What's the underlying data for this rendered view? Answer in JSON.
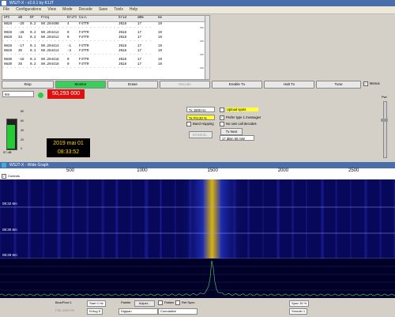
{
  "window": {
    "title": "WSJT-X - v2.0.1 by K1JT"
  },
  "menu": [
    "File",
    "Configurations",
    "View",
    "Mode",
    "Decode",
    "Save",
    "Tools",
    "Help"
  ],
  "decode": {
    "headers": [
      "UTC",
      "dB",
      "DT",
      "Freq",
      "Drift",
      "Call",
      "Grid",
      "dBm",
      "km"
    ],
    "rows": [
      {
        "utc": "0828",
        "db": "-29",
        "dt": "0.2",
        "freq": "50.294408",
        "drift": "4",
        "call": "F4TTR",
        "grid": "JN18",
        "dbm": "17",
        "km": "19"
      },
      {
        "sep": true,
        "tag": "6m"
      },
      {
        "utc": "0828",
        "db": "-28",
        "dt": "0.2",
        "freq": "50.294412",
        "drift": "0",
        "call": "F4TTR",
        "grid": "JN18",
        "dbm": "17",
        "km": "19"
      },
      {
        "utc": "0828",
        "db": "34",
        "dt": "0.2",
        "freq": "50.294412",
        "drift": "0",
        "call": "F4TTR",
        "grid": "JN18",
        "dbm": "17",
        "km": "19"
      },
      {
        "sep": true,
        "tag": "6m"
      },
      {
        "utc": "0828",
        "db": "-17",
        "dt": "0.1",
        "freq": "50.294414",
        "drift": "-1",
        "call": "F4TTR",
        "grid": "JN18",
        "dbm": "17",
        "km": "19"
      },
      {
        "utc": "0828",
        "db": "35",
        "dt": "0.1",
        "freq": "50.294414",
        "drift": "-3",
        "call": "F4TTR",
        "grid": "JN18",
        "dbm": "17",
        "km": "19"
      },
      {
        "sep": true,
        "tag": "6m"
      },
      {
        "utc": "0830",
        "db": "-16",
        "dt": "0.2",
        "freq": "50.294416",
        "drift": "0",
        "call": "F4TTR",
        "grid": "JN18",
        "dbm": "17",
        "km": "19"
      },
      {
        "utc": "0830",
        "db": "35",
        "dt": "0.2",
        "freq": "50.294416",
        "drift": "0",
        "call": "F4TTR",
        "grid": "JN18",
        "dbm": "17",
        "km": "19"
      },
      {
        "sep": true,
        "tag": "6m"
      }
    ]
  },
  "buttons": {
    "stop": "Stop",
    "monitor": "Monitor",
    "erase": "Erase",
    "decode": "Decode",
    "enable_tx": "Enable Tx",
    "halt_tx": "Halt Tx",
    "tune": "Tune",
    "menus": "Menus"
  },
  "band": "6m",
  "frequency": "50,293 000",
  "meter": {
    "ticks": [
      "80",
      "60",
      "40",
      "20",
      "0"
    ],
    "value": "57 dB",
    "level_fraction": 0.78
  },
  "clock": {
    "date": "2019 mai 01",
    "time": "08:33:52"
  },
  "controls": {
    "tx_freq": "Tx  1500  Hz",
    "tx_pct": "Tx Pct  20  %",
    "upload_spots": "Upload spots",
    "prefer_type1": "Prefer type 1 messages",
    "no_own_call": "No own call decodes",
    "band_hopping": "Band Hopping",
    "tx_next": "Tx Next",
    "schedule": "Schedule...",
    "power": "17 dBm  50 mW",
    "pwr_label": "Pwr"
  },
  "widegraph": {
    "title": "WSJT-X - Wide Graph",
    "controls_label": "Controls",
    "scale_labels": [
      "500",
      "1000",
      "1500",
      "2000",
      "2500"
    ],
    "scale_values": [
      500,
      1000,
      1500,
      2000,
      2500
    ],
    "signal_hz": 1500,
    "time_marks": [
      "08:32 6m",
      "08:30 6m",
      "08:28 6m"
    ]
  },
  "bottom": {
    "bins": "Bins/Pixel  1",
    "start": "Start  0 Hz",
    "palette": "Palette",
    "adjust": "Adjust...",
    "flatten": "Flatten",
    "ref_spec": "Ref Spec",
    "spec": "Spec  30 %",
    "fft": "N Avg  5",
    "palette_name": "Digipan",
    "cumulative": "Cumulative",
    "smooth": "Smooth  1",
    "range": "FSK 2000  FR"
  }
}
